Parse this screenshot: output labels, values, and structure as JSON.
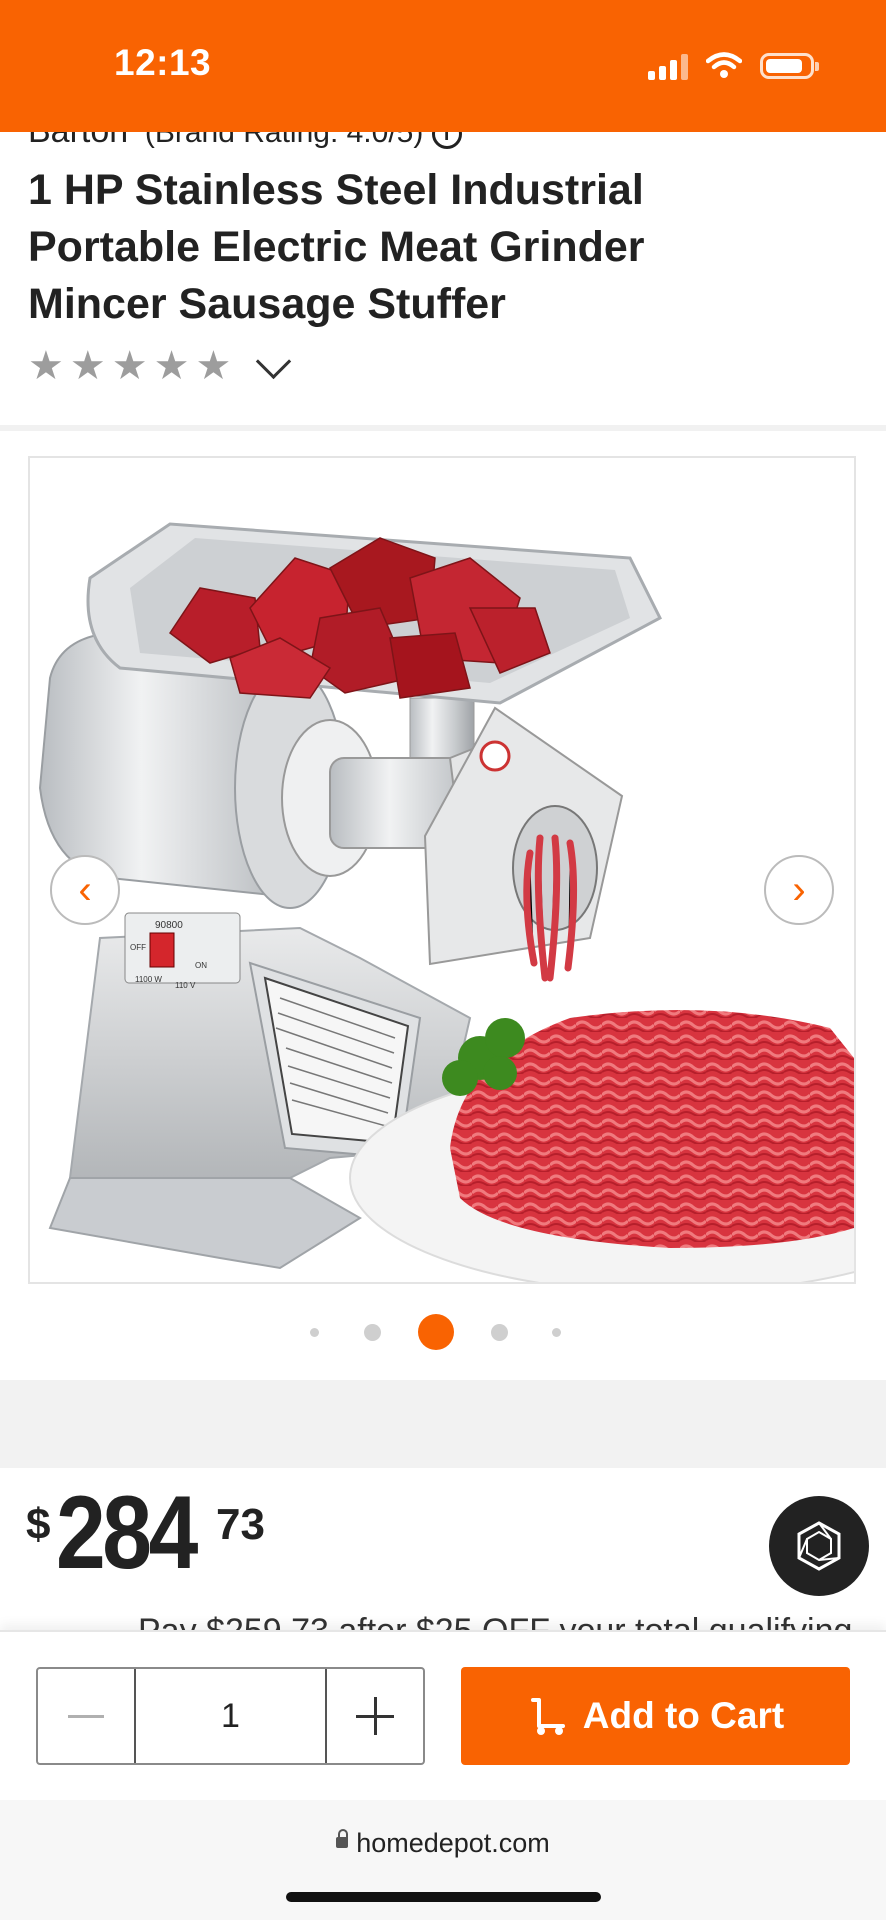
{
  "status_bar": {
    "time": "12:13"
  },
  "header": {
    "brand": "Barton",
    "brand_rating": "(Brand Rating: 4.0/5)",
    "title": "1 HP Stainless Steel Industrial Portable Electric Meat Grinder Mincer Sausage Stuffer",
    "star_count": 5
  },
  "gallery": {
    "image_alt": "Stainless steel meat grinder with tray of cubed beef and plate of ground meat",
    "machine_label": "90800",
    "switch_off": "OFF",
    "switch_on": "ON",
    "spec_watt": "1100 W",
    "spec_volt": "110 V",
    "dots_total": 5,
    "active_dot": 3
  },
  "price": {
    "currency": "$",
    "dollars": "284",
    "cents": "73",
    "promo_partial": "Pay $259.73 after $25 OFF your total qualifying"
  },
  "cart": {
    "quantity": "1",
    "add_label": "Add to Cart"
  },
  "browser": {
    "url": "homedepot.com"
  },
  "colors": {
    "brand_orange": "#f96302",
    "star_gray": "#9d9d9d"
  }
}
